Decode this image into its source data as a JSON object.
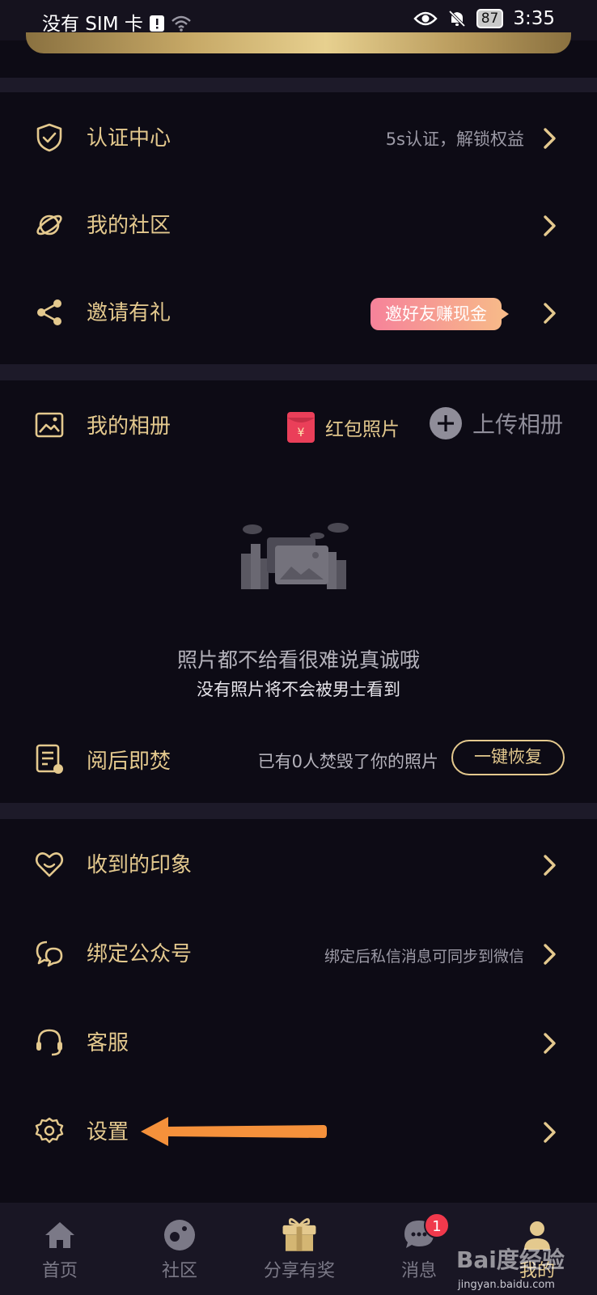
{
  "status_bar": {
    "carrier": "没有 SIM 卡",
    "battery": "87",
    "time": "3:35"
  },
  "menu_top": [
    {
      "label": "认证中心",
      "hint": "5s认证，解锁权益",
      "icon": "shield-check-icon"
    },
    {
      "label": "我的社区",
      "hint": "",
      "icon": "planet-icon"
    },
    {
      "label": "邀请有礼",
      "badge": "邀好友赚现金",
      "icon": "share-icon"
    }
  ],
  "album": {
    "title": "我的相册",
    "redpack_label": "红包照片",
    "redpack_symbol": "¥",
    "upload_label": "上传相册",
    "empty_title": "照片都不给看很难说真诚哦",
    "empty_sub": "没有照片将不会被男士看到"
  },
  "burn": {
    "label": "阅后即焚",
    "hint": "已有0人焚毁了你的照片",
    "button": "一键恢复"
  },
  "menu_bottom": [
    {
      "label": "收到的印象",
      "hint": "",
      "icon": "heart-icon"
    },
    {
      "label": "绑定公众号",
      "hint": "绑定后私信消息可同步到微信",
      "icon": "chat-bubbles-icon"
    },
    {
      "label": "客服",
      "hint": "",
      "icon": "headset-icon"
    },
    {
      "label": "设置",
      "hint": "",
      "icon": "gear-icon"
    }
  ],
  "tabbar": {
    "items": [
      {
        "label": "首页",
        "icon": "home-icon"
      },
      {
        "label": "社区",
        "icon": "community-icon"
      },
      {
        "label": "分享有奖",
        "icon": "gift-icon"
      },
      {
        "label": "消息",
        "icon": "message-icon",
        "badge": "1"
      },
      {
        "label": "我的",
        "icon": "profile-icon"
      }
    ],
    "active_index": 4
  },
  "watermark": {
    "brand": "Bai度经验",
    "url": "jingyan.baidu.com"
  },
  "colors": {
    "background": "#0d0b15",
    "accent_gold": "#e4c98e",
    "divider": "#1d1a29",
    "annotation_arrow": "#f5913b",
    "badge_red": "#f0394c"
  }
}
